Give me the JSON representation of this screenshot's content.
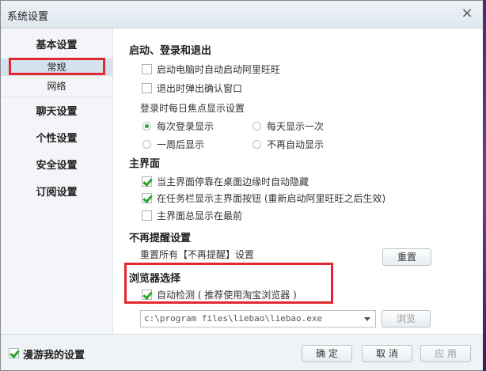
{
  "window": {
    "title": "系统设置"
  },
  "sidebar": {
    "items": [
      {
        "label": "基本设置"
      },
      {
        "label": "常规"
      },
      {
        "label": "网络"
      },
      {
        "label": "聊天设置"
      },
      {
        "label": "个性设置"
      },
      {
        "label": "安全设置"
      },
      {
        "label": "订阅设置"
      }
    ]
  },
  "startup": {
    "title": "启动、登录和退出",
    "auto_start": {
      "label": "启动电脑时自动启动阿里旺旺",
      "checked": false
    },
    "exit_confirm": {
      "label": "退出时弹出确认窗口",
      "checked": false
    },
    "focus_label": "登录时每日焦点显示设置",
    "radio_each_login": "每次登录显示",
    "radio_once_daily": "每天显示一次",
    "radio_weekly": "一周后显示",
    "radio_never": "不再自动显示"
  },
  "main_ui": {
    "title": "主界面",
    "auto_hide": {
      "label": "当主界面停靠在桌面边缘时自动隐藏",
      "checked": true
    },
    "taskbar": {
      "label": "在任务栏显示主界面按钮 (重新启动阿里旺旺之后生效)",
      "checked": true
    },
    "topmost": {
      "label": "主界面总显示在最前",
      "checked": false
    }
  },
  "reminder": {
    "title": "不再提醒设置",
    "reset_text": "重置所有【不再提醒】设置",
    "reset_button": "重置"
  },
  "browser": {
    "title": "浏览器选择",
    "auto_detect": {
      "label": "自动检测 ( 推荐使用淘宝浏览器 )",
      "checked": true
    },
    "path_value": "c:\\program files\\liebao\\liebao.exe",
    "browse_button": "浏览"
  },
  "footer": {
    "roam": {
      "label": "漫游我的设置",
      "checked": true
    },
    "ok": "确 定",
    "cancel": "取 消",
    "apply": "应 用"
  },
  "colors": {
    "accent_check": "#2aa52a",
    "highlight_box": "#e0282e"
  }
}
